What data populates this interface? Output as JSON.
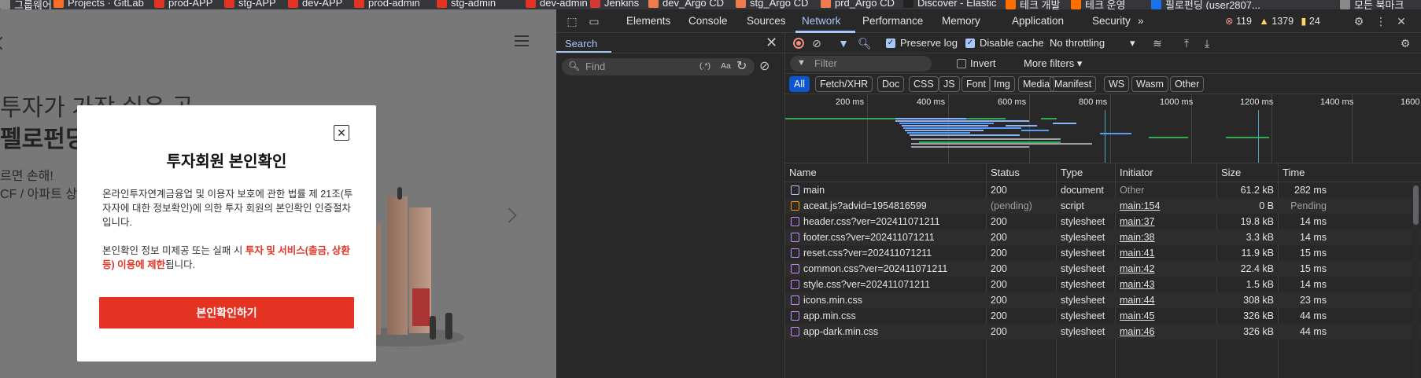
{
  "bookmarks": [
    {
      "label": "그룹웨어",
      "color": "#888"
    },
    {
      "label": "Projects · GitLab",
      "color": "#fc6d26"
    },
    {
      "label": "prod-APP",
      "color": "#e53323"
    },
    {
      "label": "stg-APP",
      "color": "#e53323"
    },
    {
      "label": "dev-APP",
      "color": "#e53323"
    },
    {
      "label": "prod-admin",
      "color": "#e53323"
    },
    {
      "label": "stg-admin",
      "color": "#e53323"
    },
    {
      "label": "dev-admin",
      "color": "#e53323"
    },
    {
      "label": "Jenkins",
      "color": "#d33833"
    },
    {
      "label": "dev_Argo CD",
      "color": "#ef7b4d"
    },
    {
      "label": "stg_Argo CD",
      "color": "#ef7b4d"
    },
    {
      "label": "prd_Argo CD",
      "color": "#ef7b4d"
    },
    {
      "label": "Discover - Elastic",
      "color": "#222"
    },
    {
      "label": "테크 개발",
      "color": "#ff6f00"
    },
    {
      "label": "테크 운영",
      "color": "#ff6f00"
    },
    {
      "label": "필로펀딩 (user2807...",
      "color": "#1a73e8"
    },
    {
      "label": "모든 북마크",
      "color": "#888"
    }
  ],
  "page": {
    "hero_title_1": "투자가 가장 쉬운 곳",
    "hero_title_2": "펠로펀딩",
    "hero_sub_1": "르면 손해!",
    "hero_sub_2": "CF / 아파트 상환"
  },
  "modal": {
    "close_symbol": "✕",
    "title": "투자회원 본인확인",
    "description": "온라인투자연계금융업 및 이용자 보호에 관한 법률 제 21조(투자자에 대한 정보확인)에 의한 투자 회원의 본인확인 인증절차입니다.",
    "warning_prefix": "본인확인 정보 미제공 또는 실패 시 ",
    "warning_highlight": "투자 및 서비스(출금, 상환 등) 이용에 제한",
    "warning_suffix": "됩니다.",
    "cta_label": "본인확인하기",
    "accent": "#e53323"
  },
  "devtools": {
    "tabs": [
      "Elements",
      "Console",
      "Sources",
      "Network",
      "Performance",
      "Memory",
      "Application",
      "Security"
    ],
    "active_tab": "Network",
    "more_tabs": "»",
    "errors": "119",
    "warnings": "1379",
    "issues": "24",
    "search": {
      "label": "Search",
      "placeholder": "Find",
      "regex_label": "(.*)",
      "case_label": "Aa"
    },
    "network": {
      "preserve_log": "Preserve log",
      "disable_cache": "Disable cache",
      "throttling": "No throttling",
      "filter_placeholder": "Filter",
      "invert": "Invert",
      "more_filters": "More filters",
      "type_filters": [
        "All",
        "Fetch/XHR",
        "Doc",
        "CSS",
        "JS",
        "Font",
        "Img",
        "Media",
        "Manifest",
        "WS",
        "Wasm",
        "Other"
      ],
      "active_type": "All",
      "timeline_ticks": [
        "200 ms",
        "400 ms",
        "600 ms",
        "800 ms",
        "1000 ms",
        "1200 ms",
        "1400 ms",
        "1600"
      ],
      "columns": [
        "Name",
        "Status",
        "Type",
        "Initiator",
        "Size",
        "Time"
      ],
      "rows": [
        {
          "name": "main",
          "status": "200",
          "type": "document",
          "initiator": "Other",
          "size": "61.2 kB",
          "time": "282 ms",
          "kind": "doc"
        },
        {
          "name": "aceat.js?advid=1954816599",
          "status": "(pending)",
          "type": "script",
          "initiator": "main:154",
          "size": "0 B",
          "time": "Pending",
          "kind": "js"
        },
        {
          "name": "header.css?ver=202411071211",
          "status": "200",
          "type": "stylesheet",
          "initiator": "main:37",
          "size": "19.8 kB",
          "time": "14 ms",
          "kind": "css"
        },
        {
          "name": "footer.css?ver=202411071211",
          "status": "200",
          "type": "stylesheet",
          "initiator": "main:38",
          "size": "3.3 kB",
          "time": "14 ms",
          "kind": "css"
        },
        {
          "name": "reset.css?ver=202411071211",
          "status": "200",
          "type": "stylesheet",
          "initiator": "main:41",
          "size": "11.9 kB",
          "time": "15 ms",
          "kind": "css"
        },
        {
          "name": "common.css?ver=202411071211",
          "status": "200",
          "type": "stylesheet",
          "initiator": "main:42",
          "size": "22.4 kB",
          "time": "15 ms",
          "kind": "css"
        },
        {
          "name": "style.css?ver=202411071211",
          "status": "200",
          "type": "stylesheet",
          "initiator": "main:43",
          "size": "1.5 kB",
          "time": "14 ms",
          "kind": "css"
        },
        {
          "name": "icons.min.css",
          "status": "200",
          "type": "stylesheet",
          "initiator": "main:44",
          "size": "308 kB",
          "time": "23 ms",
          "kind": "css"
        },
        {
          "name": "app.min.css",
          "status": "200",
          "type": "stylesheet",
          "initiator": "main:45",
          "size": "326 kB",
          "time": "44 ms",
          "kind": "css"
        },
        {
          "name": "app-dark.min.css",
          "status": "200",
          "type": "stylesheet",
          "initiator": "main:46",
          "size": "326 kB",
          "time": "44 ms",
          "kind": "css"
        }
      ]
    }
  },
  "colors": {
    "devtools_bg": "#282828",
    "active_blue": "#a8c7fa",
    "chip_active": "#0b57d0",
    "record_red": "#f28b82"
  }
}
